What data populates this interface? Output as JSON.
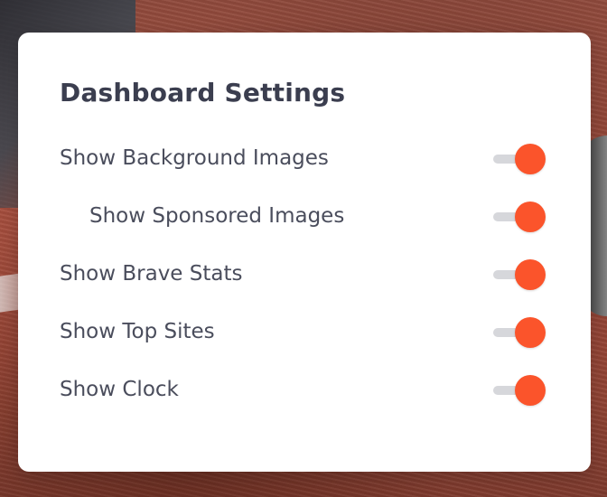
{
  "panel": {
    "title": "Dashboard Settings",
    "accent_color": "#fb542b",
    "settings": [
      {
        "label": "Show Background Images",
        "enabled": true,
        "indented": false
      },
      {
        "label": "Show Sponsored Images",
        "enabled": true,
        "indented": true
      },
      {
        "label": "Show Brave Stats",
        "enabled": true,
        "indented": false
      },
      {
        "label": "Show Top Sites",
        "enabled": true,
        "indented": false
      },
      {
        "label": "Show Clock",
        "enabled": true,
        "indented": false
      }
    ]
  }
}
